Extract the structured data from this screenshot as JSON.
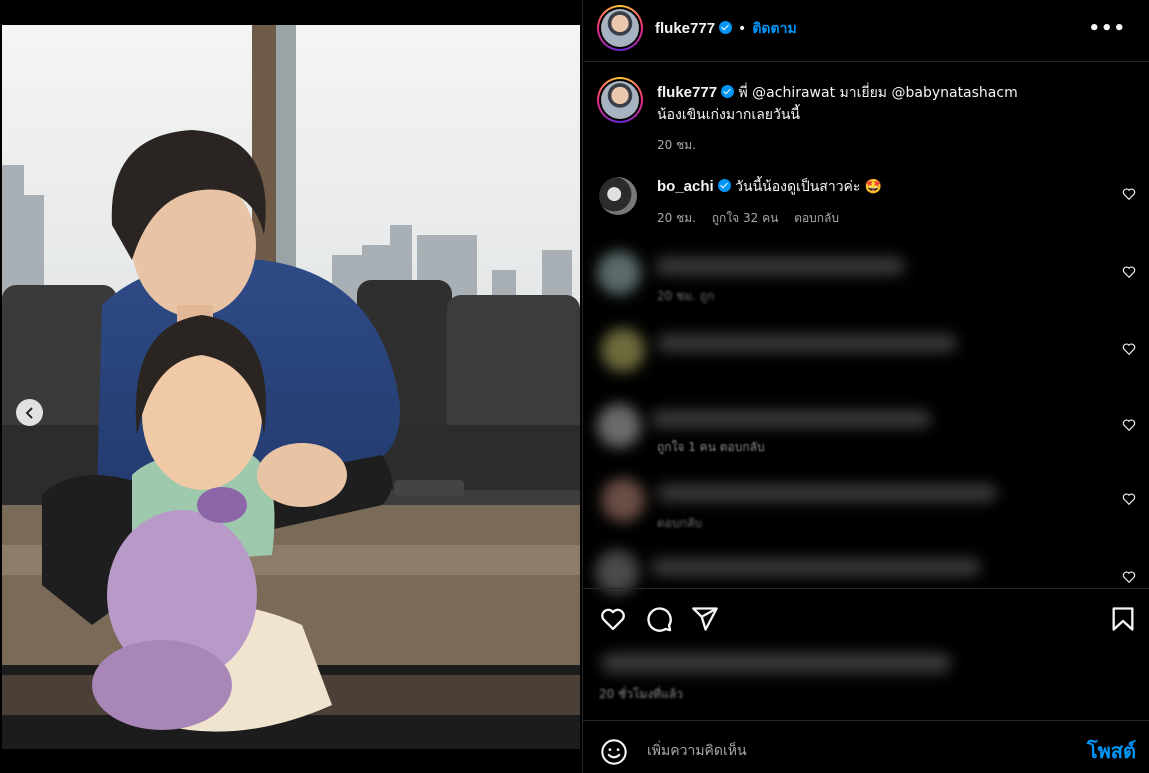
{
  "post": {
    "author": "fluke777",
    "follow_label": "ติดตาม",
    "more_label": "•••",
    "carousel": {
      "total": 2,
      "current": 2
    }
  },
  "caption": {
    "author": "fluke777",
    "line1": "พี่ @achirawat มาเยี่ยม @babynatashacm",
    "line2": "น้องเขินเก่งมากเลยวันนี้",
    "time": "20 ชม."
  },
  "comments": [
    {
      "author": "bo_achi",
      "text": "วันนี้น้องดูเป็นสาวค่ะ 🤩",
      "time": "20 ชม.",
      "likes": "ถูกใจ 32 คน",
      "reply": "ตอบกลับ"
    }
  ],
  "hidden_comments": [
    {
      "meta": "20 ชม.  ถูก"
    },
    {
      "meta": ""
    },
    {
      "meta": "ถูกใจ 1 คน   ตอบกลับ"
    },
    {
      "meta": "ตอบกลับ"
    },
    {
      "meta": ""
    }
  ],
  "footer": {
    "likes_blurred_time": "20 ชั่วโมงที่แล้ว",
    "comment_placeholder": "เพิ่มความคิดเห็น",
    "post_label": "โพสต์"
  },
  "icons": {
    "verified": "verified-badge-icon",
    "more": "more-options-icon",
    "like": "heart-icon",
    "comment": "comment-bubble-icon",
    "share": "paper-plane-icon",
    "save": "bookmark-icon",
    "emoji": "smiley-icon",
    "prev": "chevron-left-icon"
  },
  "colors": {
    "accent": "#0095f6",
    "background": "#000000",
    "muted": "#a8a8a8",
    "border": "#262626"
  }
}
